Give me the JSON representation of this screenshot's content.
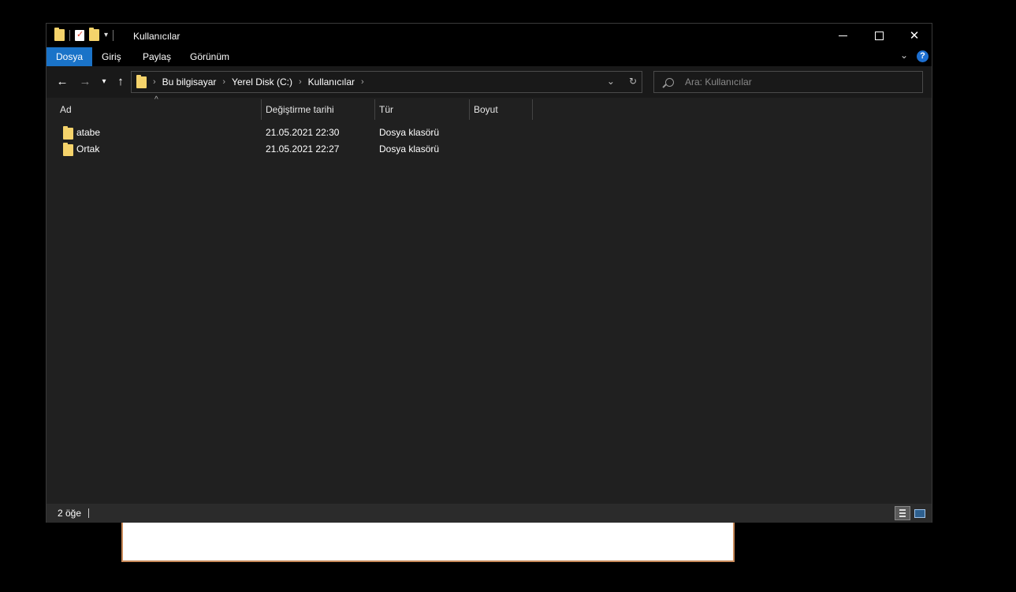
{
  "window": {
    "title": "Kullanıcılar",
    "controls": {
      "minimize": "",
      "maximize": "",
      "close": "✕"
    }
  },
  "ribbon": {
    "tabs": [
      {
        "label": "Dosya",
        "active": true
      },
      {
        "label": "Giriş"
      },
      {
        "label": "Paylaş"
      },
      {
        "label": "Görünüm"
      }
    ],
    "help": "?"
  },
  "nav": {
    "breadcrumb": [
      "Bu bilgisayar",
      "Yerel Disk (C:)",
      "Kullanıcılar"
    ],
    "search_placeholder": "Ara: Kullanıcılar"
  },
  "columns": [
    "Ad",
    "Değiştirme tarihi",
    "Tür",
    "Boyut"
  ],
  "rows": [
    {
      "name": "atabe",
      "modified": "21.05.2021 22:30",
      "type": "Dosya klasörü",
      "size": ""
    },
    {
      "name": "Ortak",
      "modified": "21.05.2021 22:27",
      "type": "Dosya klasörü",
      "size": ""
    }
  ],
  "status": {
    "count": "2 öğe"
  },
  "colors": {
    "accent": "#1a73c8",
    "folder": "#f5d36b",
    "background": "#202020"
  },
  "icons": [
    "folder-icon",
    "properties-icon",
    "back-arrow-icon",
    "forward-arrow-icon",
    "up-arrow-icon",
    "refresh-icon",
    "search-icon",
    "help-icon"
  ]
}
